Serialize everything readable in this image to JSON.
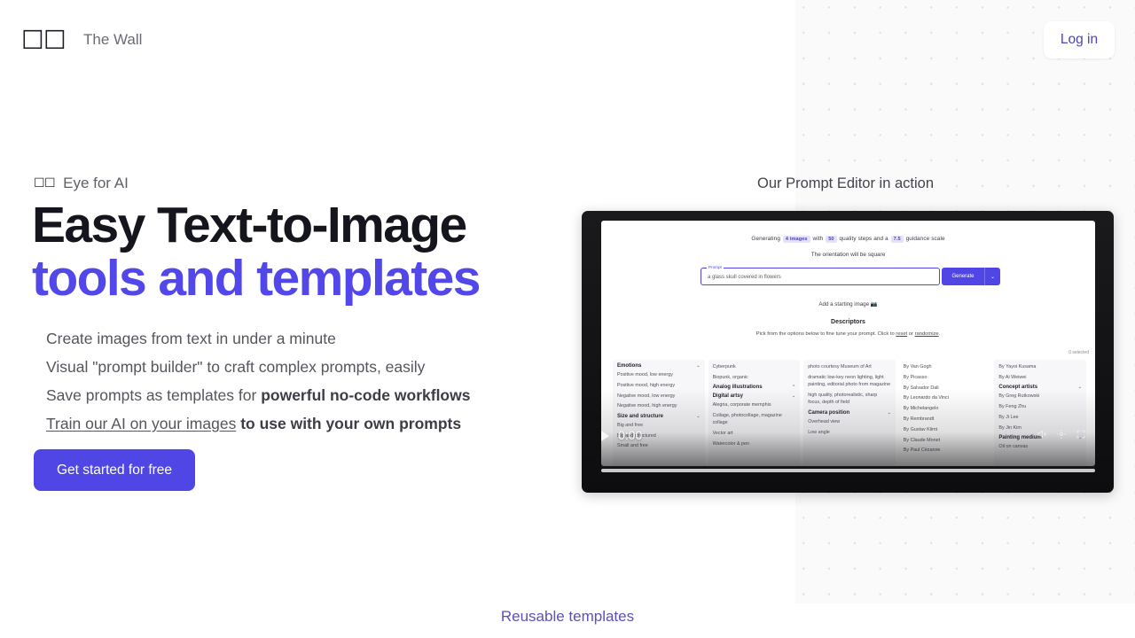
{
  "header": {
    "logo_glyphs": "☐☐",
    "brand": "The Wall",
    "login_label": "Log in"
  },
  "hero": {
    "eyebrow_glyphs": "☐☐",
    "eyebrow": "Eye for AI",
    "headline_line1": "Easy Text-to-Image",
    "headline_line2": "tools and templates",
    "features": [
      {
        "plain": "Create images from text in under a minute"
      },
      {
        "plain": "Visual \"prompt builder\" to craft complex prompts, easily"
      },
      {
        "plain": "Save prompts as templates for ",
        "bold": "powerful no-code workflows"
      },
      {
        "underline": "Train our AI on your images",
        "bold": " to use with your own prompts"
      }
    ],
    "cta_label": "Get started for free",
    "bottom_link": "Reusable templates"
  },
  "demo": {
    "caption": "Our Prompt Editor in action",
    "player": {
      "time": "0:00",
      "play_icon": "play-icon",
      "mute_icon": "volume-muted-icon",
      "settings_icon": "settings-icon",
      "fullscreen_icon": "fullscreen-icon"
    },
    "app": {
      "generating_pre": "Generating",
      "chip_images": "4 images",
      "generating_mid": "with",
      "chip_steps": "50",
      "generating_mid2": "quality steps and a",
      "chip_guidance": "7.5",
      "generating_post": "guidance scale",
      "orientation_pre": "The orientation will be",
      "chip_orientation": "square",
      "prompt_label": "Prompt",
      "prompt_value": "a glass skull covered in flowers",
      "generate_label": "Generate",
      "generate_caret": "⌄",
      "start_image": "Add a starting image 📷",
      "descriptors_title": "Descriptors",
      "descriptors_sub_pre": "Pick from the options below to fine tune your prompt. Click to ",
      "descriptors_reset": "reset",
      "descriptors_or": " or ",
      "descriptors_randomize": "randomize",
      "descriptors_sub_post": ".",
      "selected_count": "0 selected",
      "columns": [
        {
          "groups": [
            {
              "title": "Emotions",
              "chevron": "⌄",
              "options": [
                "Positive mood, low energy",
                "Positive mood, high energy",
                "Negative mood, low energy",
                "Negative mood, high energy"
              ]
            },
            {
              "title": "Size and structure",
              "chevron": "⌄",
              "options": [
                "Big and free",
                "Big and structured",
                "Small and free"
              ]
            }
          ]
        },
        {
          "lead_options": [
            "Cyberpunk",
            "Biopunk, organic"
          ],
          "groups": [
            {
              "title": "Analog illustrations",
              "chevron": "⌃",
              "options": []
            },
            {
              "title": "Digital artsy",
              "chevron": "⌄",
              "options": [
                "Alegria, corporate memphis",
                "Collage, photocollage, magazine collage",
                "Vector art",
                "Watercolor & pen"
              ]
            }
          ]
        },
        {
          "lead_options": [
            "photo courtesy Museum of Art",
            "dramatic low-key neon lighting, light painting, editorial photo from magazine",
            "high quality, photorealistic, sharp focus, depth of field"
          ],
          "groups": [
            {
              "title": "Camera position",
              "chevron": "⌄",
              "options": [
                "Overhead view",
                "Low angle"
              ]
            }
          ]
        },
        {
          "lead_options": [
            "By Van Gogh",
            "By Picasso",
            "By Salvador Dali",
            "By Leonardo da Vinci",
            "By Michelangelo",
            "By Rembrandt",
            "By Gustav Klimt",
            "By Claude Monet",
            "By Paul Cézanne"
          ],
          "groups": []
        },
        {
          "lead_options": [
            "By Yayoi Kusama",
            "By Ai Weiwei"
          ],
          "groups": [
            {
              "title": "Concept artists",
              "chevron": "⌄",
              "options": [
                "By Greg Rutkowski",
                "By Feng Zhu",
                "By Ji Lee",
                "By Jin Kim"
              ]
            },
            {
              "title": "Painting medium",
              "chevron": "⌄",
              "options": [
                "Oil on canvas"
              ]
            }
          ]
        }
      ]
    }
  },
  "colors": {
    "accent": "#4f46e5",
    "headline_accent": "#5247e8",
    "login_text": "#4a43c4",
    "bottom_link": "#5b51b8",
    "dot_grid": "#e2e2e8",
    "panel_bg": "#fafafb"
  }
}
